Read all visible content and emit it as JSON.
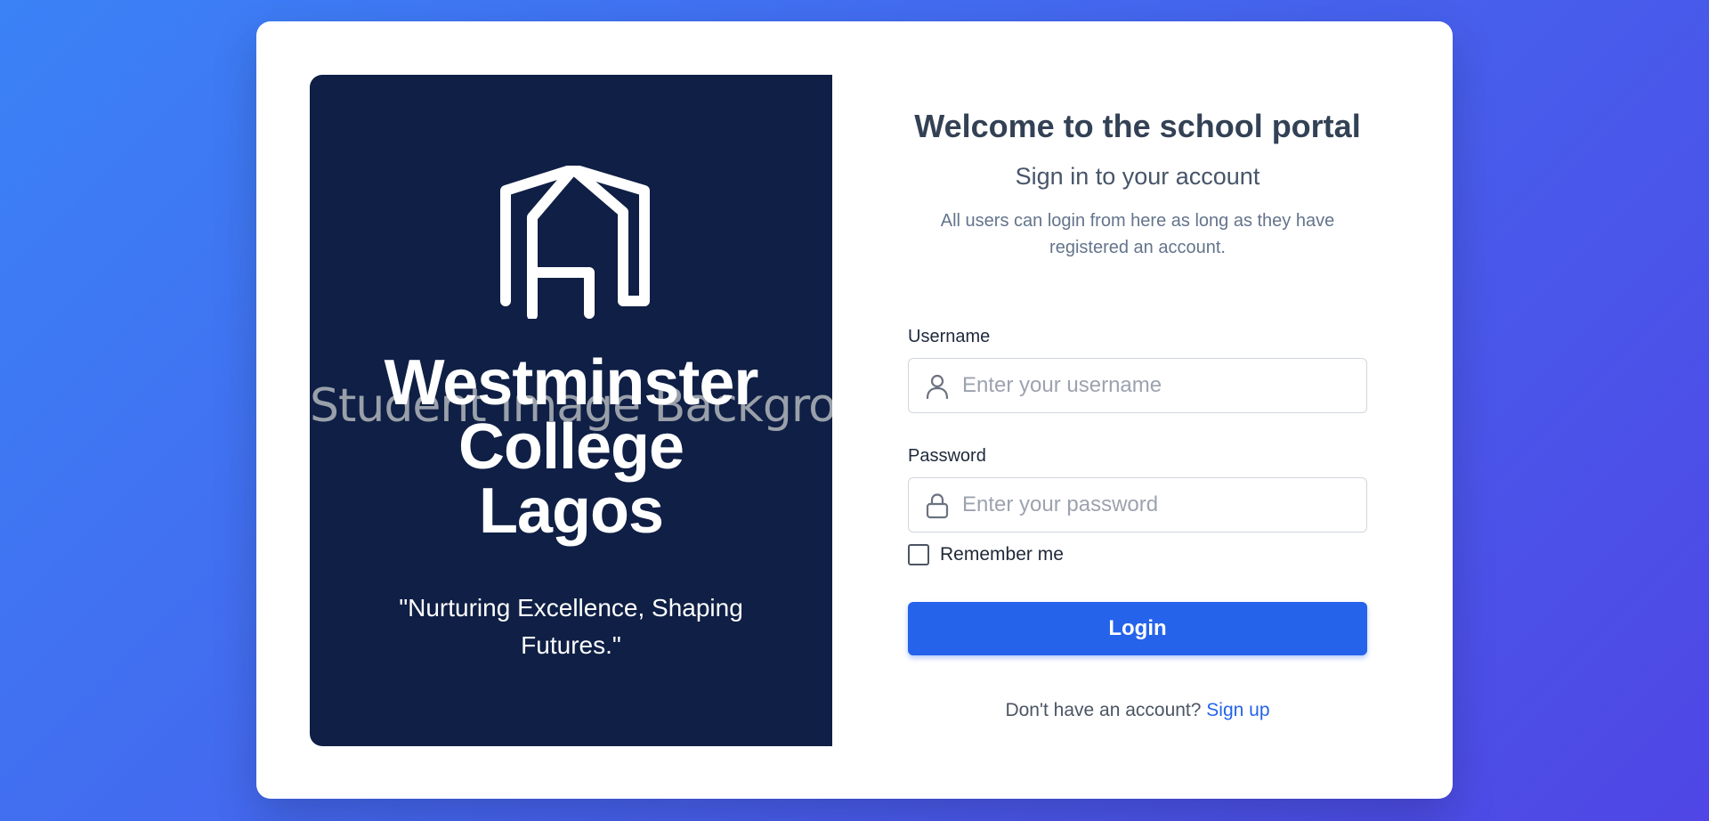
{
  "branding": {
    "school_name_line1": "Westminster",
    "school_name_line2": "College",
    "school_name_line3": "Lagos",
    "motto": "\"Nurturing Excellence, Shaping Futures.\"",
    "background_alt_text": "Student Image Background",
    "logo_icon": "school-building-icon"
  },
  "login": {
    "title": "Welcome to the school portal",
    "subtitle": "Sign in to your account",
    "description": "All users can login from here as long as they have registered an account.",
    "username": {
      "label": "Username",
      "placeholder": "Enter your username",
      "value": "",
      "icon": "user-icon"
    },
    "password": {
      "label": "Password",
      "placeholder": "Enter your password",
      "value": "",
      "icon": "lock-icon"
    },
    "remember_label": "Remember me",
    "remember_checked": false,
    "submit_label": "Login",
    "signup_prompt": "Don't have an account?",
    "signup_link": "Sign up"
  },
  "colors": {
    "background_start": "#3b82f6",
    "background_end": "#4f46e5",
    "panel_dark": "#0f1f45",
    "accent": "#2563eb"
  }
}
